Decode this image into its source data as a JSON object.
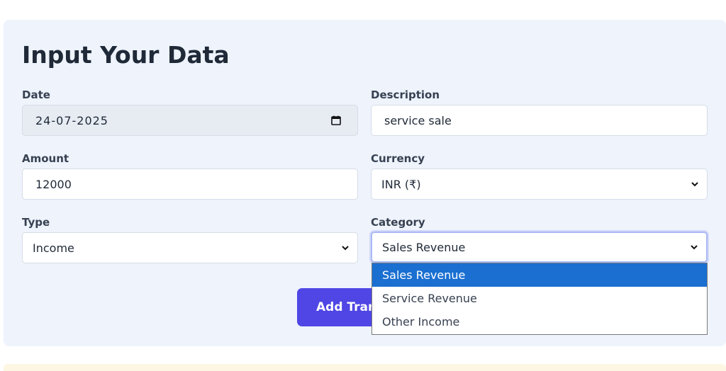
{
  "form": {
    "title": "Input Your Data",
    "date": {
      "label": "Date",
      "value": "24-07-2025"
    },
    "description": {
      "label": "Description",
      "value": "service sale"
    },
    "amount": {
      "label": "Amount",
      "value": "12000"
    },
    "currency": {
      "label": "Currency",
      "value": "INR (₹)"
    },
    "type": {
      "label": "Type",
      "value": "Income"
    },
    "category": {
      "label": "Category",
      "value": "Sales Revenue",
      "options": [
        "Sales Revenue",
        "Service Revenue",
        "Other Income"
      ],
      "selected_index": 0
    },
    "submit_label": "Add Transaction"
  },
  "icons": {
    "calendar": "calendar-icon",
    "dropdown": "chevron-down-icon"
  },
  "colors": {
    "card_bg": "#eef3fc",
    "button_bg": "#4f46e5",
    "option_highlight": "#1a6fd1",
    "date_field_bg": "#e7ecf3"
  }
}
